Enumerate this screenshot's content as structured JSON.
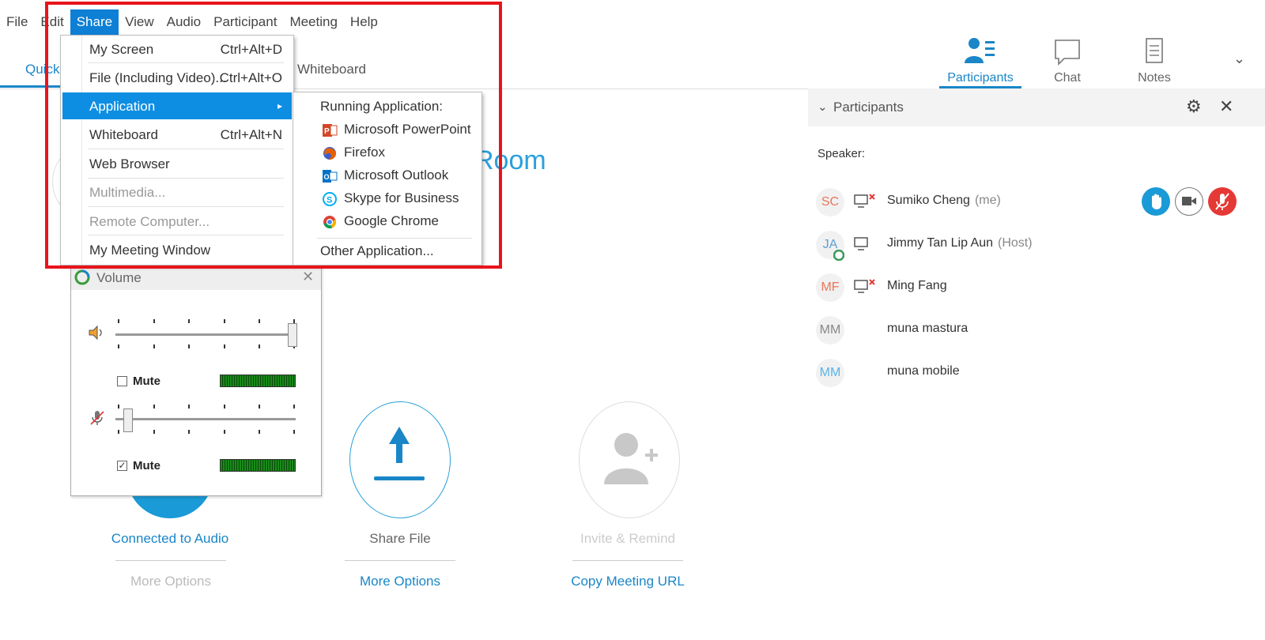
{
  "menubar": {
    "items": [
      {
        "label": "File"
      },
      {
        "label": "Edit"
      },
      {
        "label": "Share"
      },
      {
        "label": "View"
      },
      {
        "label": "Audio"
      },
      {
        "label": "Participant"
      },
      {
        "label": "Meeting"
      },
      {
        "label": "Help"
      }
    ]
  },
  "toolbar": {
    "participants": "Participants",
    "chat": "Chat",
    "notes": "Notes"
  },
  "tabs": {
    "quick": "Quick Start",
    "whiteboard": "Whiteboard"
  },
  "main": {
    "room_title": "Room",
    "audio_label": "Connected to Audio",
    "audio_more": "More Options",
    "share_label": "Share File",
    "share_more": "More Options",
    "invite_label": "Invite & Remind",
    "invite_more": "Copy Meeting URL"
  },
  "share_menu": {
    "items": [
      {
        "label": "My Screen",
        "shortcut": "Ctrl+Alt+D",
        "enabled": true
      },
      {
        "label": "File (Including Video)...",
        "shortcut": "Ctrl+Alt+O",
        "enabled": true
      },
      {
        "label": "Application",
        "shortcut": "",
        "enabled": true,
        "highlighted": true
      },
      {
        "label": "Whiteboard",
        "shortcut": "Ctrl+Alt+N",
        "enabled": true
      },
      {
        "label": "Web Browser",
        "shortcut": "",
        "enabled": true
      },
      {
        "label": "Multimedia...",
        "shortcut": "",
        "enabled": false
      },
      {
        "label": "Remote Computer...",
        "shortcut": "",
        "enabled": false
      },
      {
        "label": "My Meeting Window",
        "shortcut": "",
        "enabled": true
      }
    ]
  },
  "app_menu": {
    "header": "Running Application:",
    "apps": [
      {
        "label": "Microsoft PowerPoint",
        "icon": "powerpoint-icon",
        "color": "#d24726"
      },
      {
        "label": "Firefox",
        "icon": "firefox-icon",
        "color": "#e66000"
      },
      {
        "label": "Microsoft Outlook",
        "icon": "outlook-icon",
        "color": "#0072c6"
      },
      {
        "label": "Skype for Business",
        "icon": "skype-icon",
        "color": "#00aff0"
      },
      {
        "label": "Google Chrome",
        "icon": "chrome-icon",
        "color": "#4285f4"
      }
    ],
    "other": "Other Application..."
  },
  "volume": {
    "title": "Volume",
    "speaker_mute_label": "Mute",
    "speaker_muted": false,
    "speaker_level": 1.0,
    "mic_mute_label": "Mute",
    "mic_muted": true,
    "mic_level": 0.08
  },
  "participants_panel": {
    "title": "Participants",
    "speaker_label": "Speaker:",
    "people": [
      {
        "initials": "SC",
        "name": "Sumiko Cheng",
        "tag": "(me)",
        "initials_color": "#e8765a",
        "screen_icon": true,
        "screen_x": true
      },
      {
        "initials": "JA",
        "name": "Jimmy Tan Lip Aun",
        "tag": "(Host)",
        "initials_color": "#5a9fd6",
        "screen_icon": true,
        "screen_x": false
      },
      {
        "initials": "MF",
        "name": "Ming Fang",
        "tag": "",
        "initials_color": "#e8765a",
        "screen_icon": true,
        "screen_x": true
      },
      {
        "initials": "MM",
        "name": "muna mastura",
        "tag": "",
        "initials_color": "#888888",
        "screen_icon": false,
        "screen_x": false
      },
      {
        "initials": "MM",
        "name": "muna mobile",
        "tag": "",
        "initials_color": "#5ab4e6",
        "screen_icon": false,
        "screen_x": false
      }
    ]
  },
  "colors": {
    "accent": "#1a86c8",
    "menu_highlight": "#0d8ee3",
    "annotation_red": "#e8141b",
    "mute_red": "#e53935",
    "raise_hand_blue": "#1a9ad6"
  }
}
